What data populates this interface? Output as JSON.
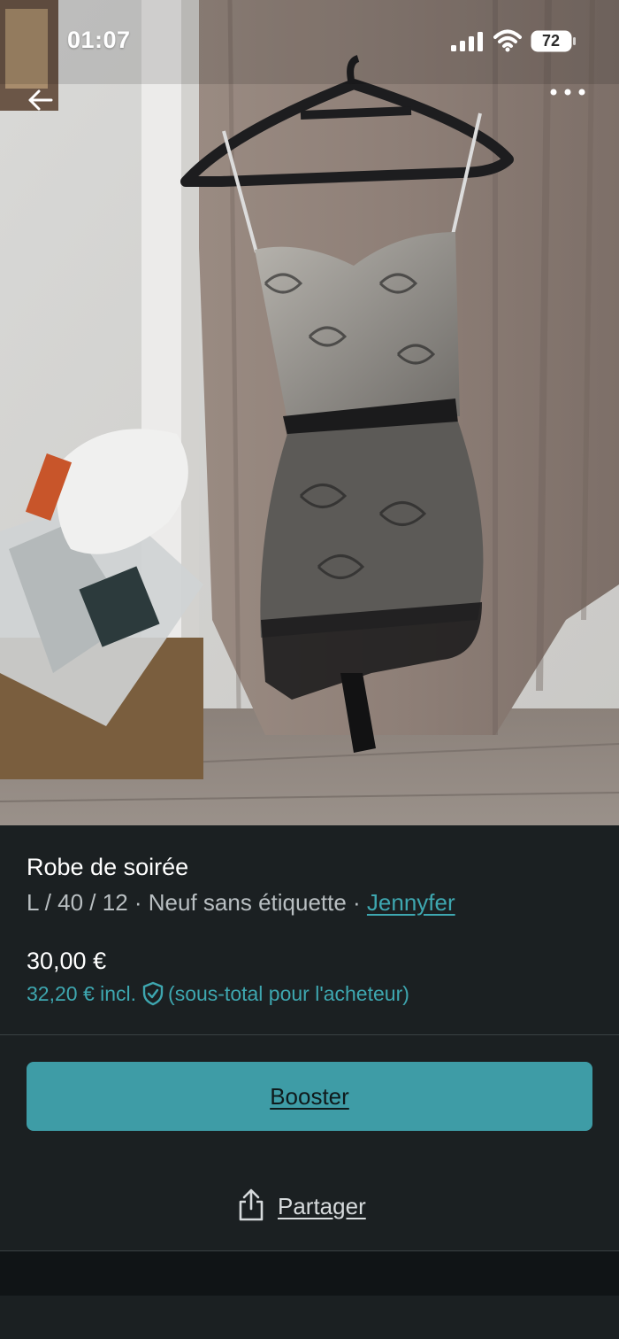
{
  "status_bar": {
    "time": "01:07",
    "battery": "72"
  },
  "photo": {
    "icon_back": "arrow-left-icon",
    "icon_more": "more-horizontal-icon"
  },
  "listing": {
    "title": "Robe de soirée",
    "size_condition": "L / 40 / 12 · Neuf sans étiquette · ",
    "brand": "Jennyfer",
    "price": "30,00 €",
    "price_incl": "32,20 € incl.",
    "price_incl_note": "(sous-total pour l'acheteur)"
  },
  "actions": {
    "boost_label": "Booster",
    "share_label": "Partager"
  },
  "colors": {
    "accent": "#3ea7b0",
    "button": "#3e9ca6",
    "background": "#1b2022"
  }
}
